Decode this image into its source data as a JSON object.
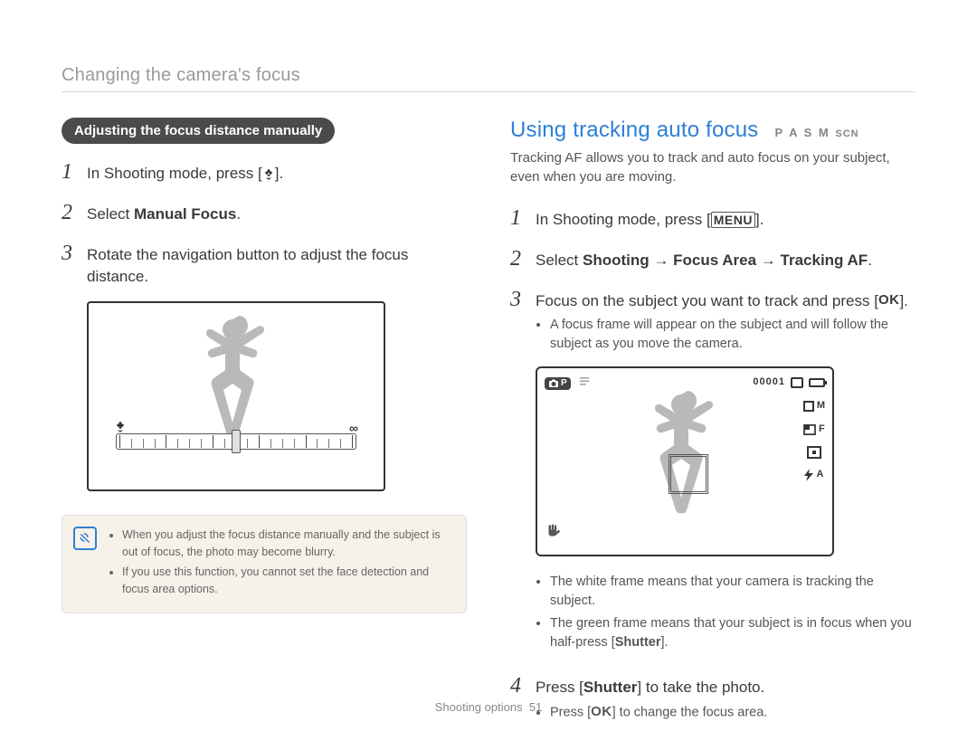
{
  "header": {
    "title": "Changing the camera's focus"
  },
  "left": {
    "pill": "Adjusting the focus distance manually",
    "steps": {
      "s1_pre": "In Shooting mode, press [",
      "s1_post": "].",
      "s2_pre": "Select ",
      "s2_bold": "Manual Focus",
      "s2_post": ".",
      "s3": "Rotate the navigation button to adjust the focus distance."
    },
    "slider_inf": "∞",
    "note": {
      "b1": "When you adjust the focus distance manually and the subject is out of focus, the photo may become blurry.",
      "b2": "If you use this function, you cannot set the face detection and focus area options."
    }
  },
  "right": {
    "heading": "Using tracking auto focus",
    "modes": {
      "p": "P",
      "a": "A",
      "s": "S",
      "m": "M",
      "scn": "SCN"
    },
    "intro": "Tracking AF allows you to track and auto focus on your subject, even when you are moving.",
    "steps": {
      "s1_pre": "In Shooting mode, press [",
      "s1_icon": "MENU",
      "s1_post": "].",
      "s2_pre": "Select ",
      "s2_b1": "Shooting",
      "s2_arrow1": " → ",
      "s2_b2": "Focus Area",
      "s2_arrow2": " → ",
      "s2_b3": "Tracking AF",
      "s2_post": ".",
      "s3_pre": "Focus on  the subject you want to track and press [",
      "s3_icon": "OK",
      "s3_post": "].",
      "s3_bullet": "A focus frame will appear on the subject and will follow the subject as you move the camera.",
      "post_fig_b1": "The white frame means that your camera is tracking the subject.",
      "post_fig_b2_pre": "The green frame means that your subject is in focus when you half-press [",
      "post_fig_b2_bold": "Shutter",
      "post_fig_b2_post": "].",
      "s4_pre": "Press [",
      "s4_bold": "Shutter",
      "s4_post": "] to take the photo.",
      "s4_bullet_pre": "Press [",
      "s4_bullet_icon": "OK",
      "s4_bullet_post": "] to change the focus area."
    },
    "hud": {
      "counter": "00001",
      "size_suffix": "M",
      "fine_suffix": "F",
      "flash_suffix": "A"
    }
  },
  "footer": {
    "section": "Shooting options",
    "page": "51"
  }
}
